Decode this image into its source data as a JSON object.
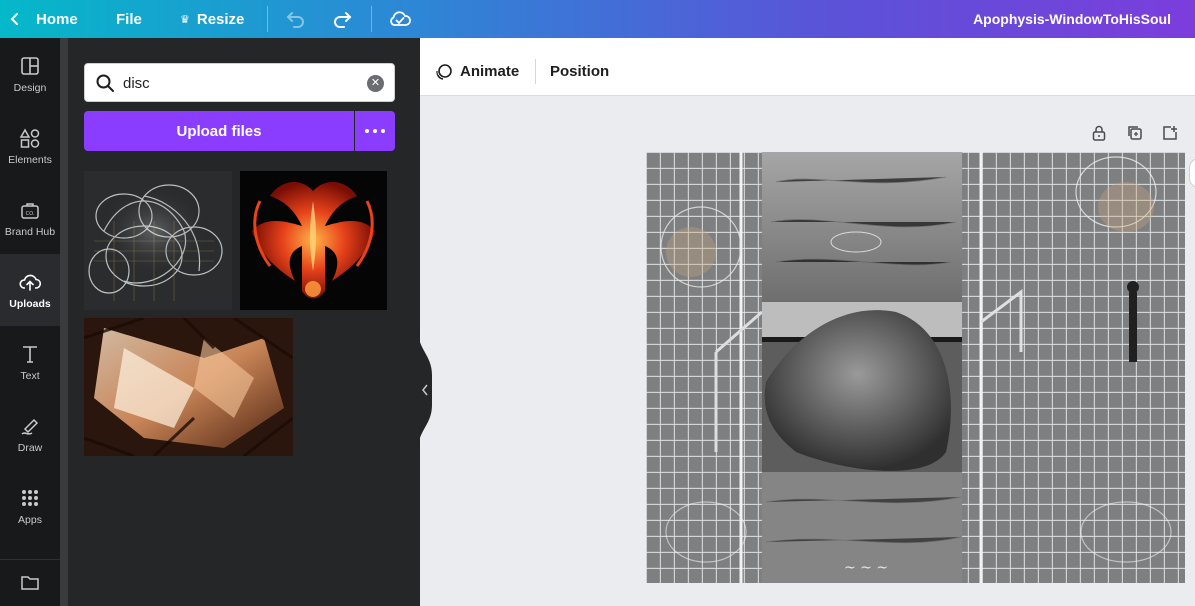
{
  "topbar": {
    "home_label": "Home",
    "file_label": "File",
    "resize_label": "Resize",
    "document_title": "Apophysis-WindowToHisSoul"
  },
  "rail": {
    "items": [
      {
        "label": "Design",
        "icon": "layout-icon"
      },
      {
        "label": "Elements",
        "icon": "shapes-icon"
      },
      {
        "label": "Brand Hub",
        "icon": "brand-icon"
      },
      {
        "label": "Uploads",
        "icon": "cloud-upload-icon",
        "active": true
      },
      {
        "label": "Text",
        "icon": "text-icon"
      },
      {
        "label": "Draw",
        "icon": "draw-icon"
      },
      {
        "label": "Apps",
        "icon": "apps-icon"
      }
    ]
  },
  "panel": {
    "search_value": "disc",
    "upload_label": "Upload files"
  },
  "context_toolbar": {
    "animate_label": "Animate",
    "position_label": "Position"
  },
  "colors": {
    "accent": "#8b3dff",
    "rail_bg": "#18191b",
    "panel_bg": "#252627",
    "canvas_bg": "#ebecf0"
  }
}
